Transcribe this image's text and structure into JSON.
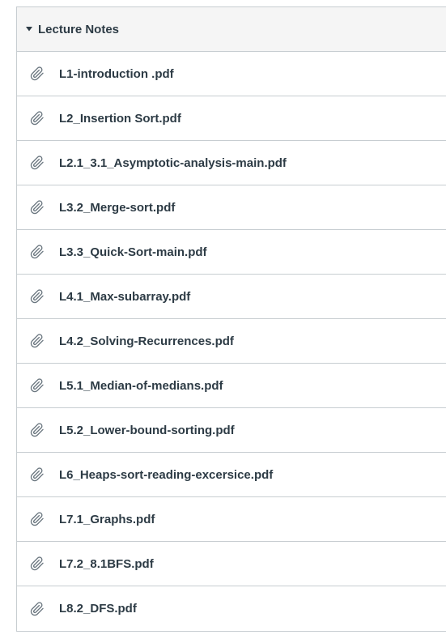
{
  "module": {
    "title": "Lecture Notes",
    "expanded_icon": "caret-down-icon",
    "item_icon": "paperclip-icon",
    "items": [
      {
        "label": "L1-introduction .pdf"
      },
      {
        "label": "L2_Insertion Sort.pdf"
      },
      {
        "label": "L2.1_3.1_Asymptotic-analysis-main.pdf"
      },
      {
        "label": "L3.2_Merge-sort.pdf"
      },
      {
        "label": "L3.3_Quick-Sort-main.pdf"
      },
      {
        "label": "L4.1_Max-subarray.pdf"
      },
      {
        "label": "L4.2_Solving-Recurrences.pdf"
      },
      {
        "label": "L5.1_Median-of-medians.pdf"
      },
      {
        "label": "L5.2_Lower-bound-sorting.pdf"
      },
      {
        "label": "L6_Heaps-sort-reading-excersice.pdf"
      },
      {
        "label": "L7.1_Graphs.pdf"
      },
      {
        "label": "L7.2_8.1BFS.pdf"
      },
      {
        "label": "L8.2_DFS.pdf"
      }
    ]
  },
  "colors": {
    "text": "#2d3b45",
    "icon": "#6b7780",
    "border": "#c7cdd1",
    "header_bg": "#f5f5f5"
  }
}
